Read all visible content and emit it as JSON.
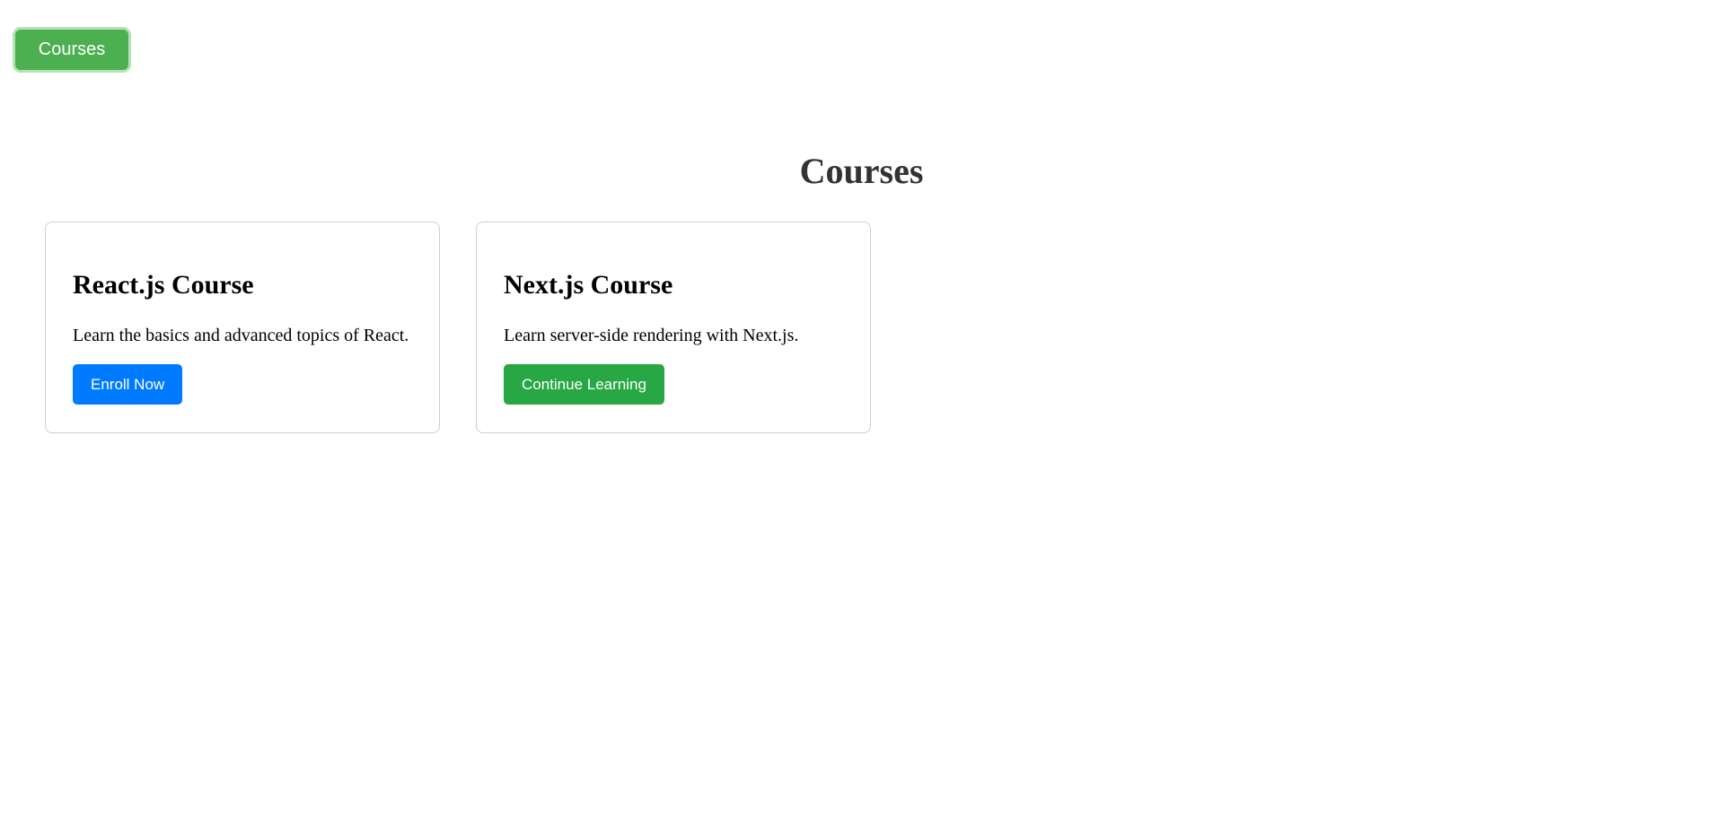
{
  "nav": {
    "courses_label": "Courses"
  },
  "main": {
    "title": "Courses",
    "courses": [
      {
        "title": "React.js Course",
        "description": "Learn the basics and advanced topics of React.",
        "action_label": "Enroll Now",
        "action_color": "#007bff"
      },
      {
        "title": "Next.js Course",
        "description": "Learn server-side rendering with Next.js.",
        "action_label": "Continue Learning",
        "action_color": "#28a745"
      }
    ]
  },
  "colors": {
    "nav_button": "#4caf50",
    "nav_button_ring": "#b5e2b7",
    "title_text": "#333333",
    "card_border": "#cfcfcf"
  }
}
